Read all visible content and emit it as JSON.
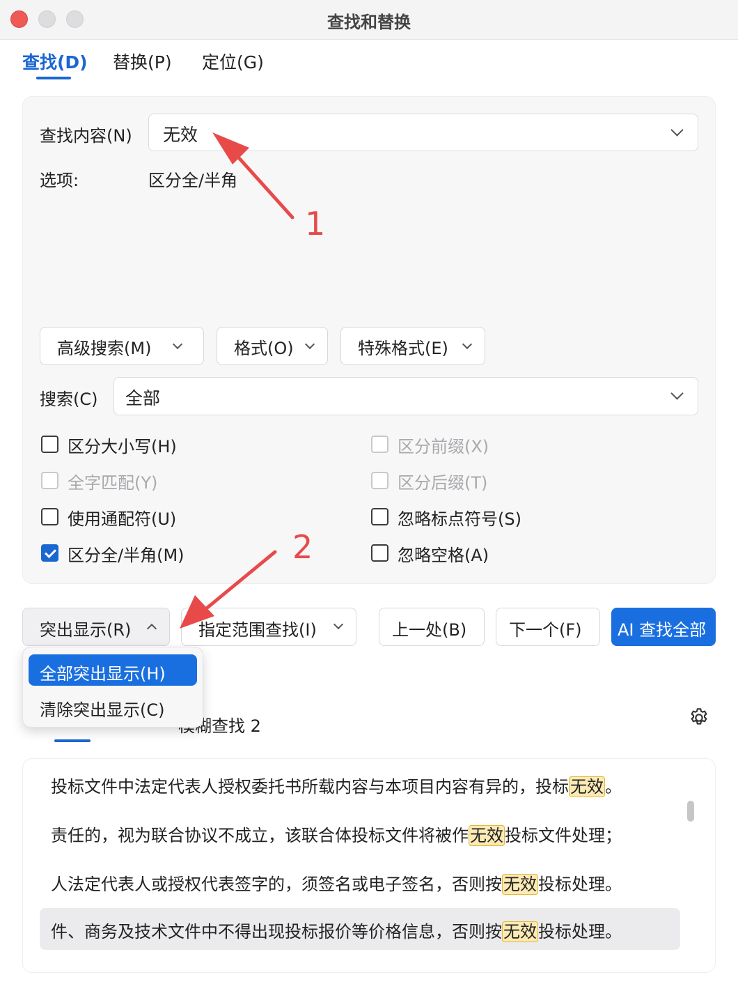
{
  "window": {
    "title": "查找和替换"
  },
  "tabs": [
    {
      "label": "查找(D)"
    },
    {
      "label": "替换(P)"
    },
    {
      "label": "定位(G)"
    }
  ],
  "find": {
    "label": "查找内容(N)",
    "value": "无效",
    "options_label": "选项:",
    "options_value": "区分全/半角"
  },
  "toolbar": {
    "advanced": "高级搜索(M)",
    "format": "格式(O)",
    "special": "特殊格式(E)"
  },
  "search": {
    "label": "搜索(C)",
    "value": "全部"
  },
  "checkboxes": [
    {
      "label": "区分大小写(H)",
      "checked": false,
      "disabled": false
    },
    {
      "label": "区分前缀(X)",
      "checked": false,
      "disabled": true
    },
    {
      "label": "全字匹配(Y)",
      "checked": false,
      "disabled": true
    },
    {
      "label": "区分后缀(T)",
      "checked": false,
      "disabled": true
    },
    {
      "label": "使用通配符(U)",
      "checked": false,
      "disabled": false
    },
    {
      "label": "忽略标点符号(S)",
      "checked": false,
      "disabled": false
    },
    {
      "label": "区分全/半角(M)",
      "checked": true,
      "disabled": false
    },
    {
      "label": "忽略空格(A)",
      "checked": false,
      "disabled": false
    }
  ],
  "actions": {
    "highlight": "突出显示(R)",
    "range_find": "指定范围查找(I)",
    "prev": "上一处(B)",
    "next": "下一个(F)",
    "ai_find_all": "AI 查找全部"
  },
  "highlight_menu": [
    {
      "label": "全部突出显示(H)",
      "selected": true
    },
    {
      "label": "清除突出显示(C)",
      "selected": false
    }
  ],
  "results_tabs": {
    "fuzzy": "模糊查找 2"
  },
  "results": [
    {
      "before": "投标文件中法定代表人授权委托书所载内容与本项目内容有异的，投标",
      "match": "无效",
      "after": "。"
    },
    {
      "before": "责任的，视为联合协议不成立，该联合体投标文件将被作",
      "match": "无效",
      "after": "投标文件处理；"
    },
    {
      "before": "人法定代表人或授权代表签字的，须签名或电子签名，否则按",
      "match": "无效",
      "after": "投标处理。"
    },
    {
      "before": "件、商务及技术文件中不得出现投标报价等价格信息，否则按",
      "match": "无效",
      "after": "投标处理。"
    }
  ],
  "annotations": {
    "one": "1",
    "two": "2"
  },
  "colors": {
    "accent": "#1a67d2",
    "primary_button": "#1a6fe0",
    "annotation": "#e84a4a",
    "match_highlight": "#fbeab4"
  }
}
